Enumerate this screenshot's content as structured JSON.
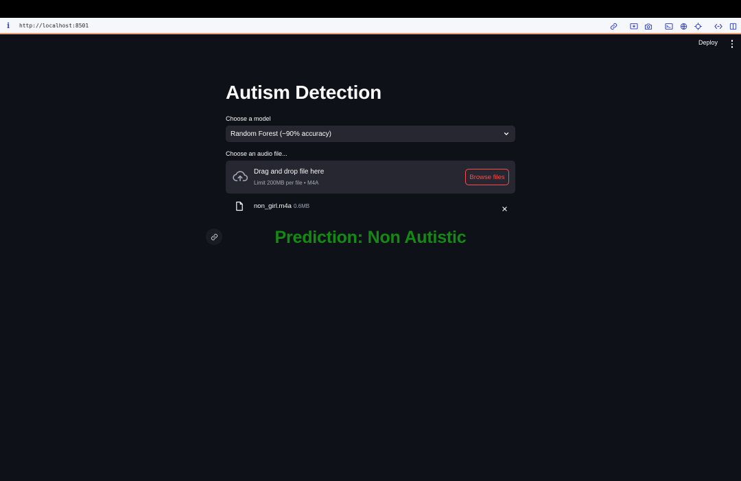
{
  "browser": {
    "url": "http://localhost:8501",
    "info_icon": "i",
    "icons": [
      "link-icon",
      "screen-capture-icon",
      "camera-icon",
      "terminal-icon",
      "globe-icon",
      "crosshair-icon",
      "code-icon",
      "split-view-icon"
    ],
    "accent": "#3b4bd8"
  },
  "header": {
    "deploy_label": "Deploy",
    "menu_icon": "kebab-menu-icon"
  },
  "main": {
    "title": "Autism Detection",
    "model_label": "Choose a model",
    "model_selected": "Random Forest (~90% accuracy)",
    "file_label": "Choose an audio file...",
    "dropzone": {
      "title": "Drag and drop file here",
      "subtitle": "Limit 200MB per file • M4A",
      "browse_label": "Browse files"
    },
    "uploaded_file": {
      "name": "non_girl.m4a",
      "size": "0.6MB"
    },
    "prediction": "Prediction: Non Autistic"
  },
  "colors": {
    "background": "#0e1117",
    "widget": "#262730",
    "primary": "#ff4b4b",
    "prediction": "#138a13"
  }
}
